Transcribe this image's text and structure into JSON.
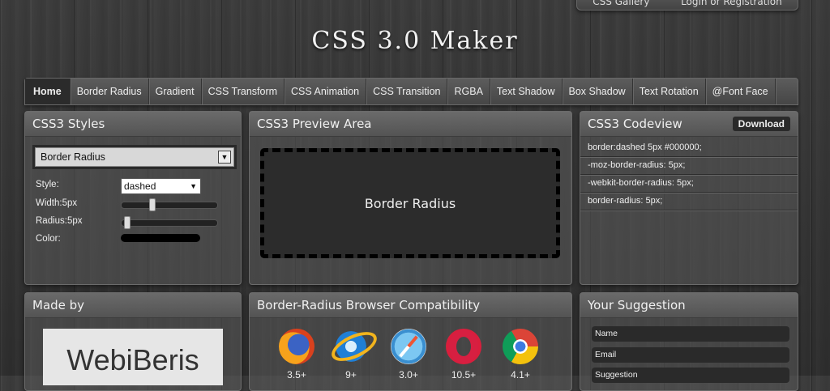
{
  "top_links": {
    "gallery": "CSS Gallery",
    "login": "Login or Registration"
  },
  "logo": "CSS 3.0 Maker",
  "nav": {
    "tabs": [
      "Home",
      "Border Radius",
      "Gradient",
      "CSS Transform",
      "CSS Animation",
      "CSS Transition",
      "RGBA",
      "Text Shadow",
      "Box Shadow",
      "Text Rotation",
      "@Font Face"
    ],
    "active_index": 0
  },
  "styles_panel": {
    "title": "CSS3 Styles",
    "selected_style": "Border Radius",
    "style_label": "Style:",
    "style_value": "dashed",
    "width_label": "Width:5px",
    "width_value": 5,
    "radius_label": "Radius:5px",
    "radius_value": 5,
    "color_label": "Color:",
    "color_value": "#000000"
  },
  "preview_panel": {
    "title": "CSS3 Preview Area",
    "preview_text": "Border Radius"
  },
  "codeview_panel": {
    "title": "CSS3 Codeview",
    "download_label": "Download",
    "lines": [
      "border:dashed 5px #000000;",
      "-moz-border-radius: 5px;",
      "-webkit-border-radius: 5px;",
      "border-radius: 5px;"
    ]
  },
  "madeby_panel": {
    "title": "Made by",
    "brand": "WebiBeris"
  },
  "compat_panel": {
    "title": "Border-Radius Browser Compatibility",
    "browsers": [
      {
        "icon": "firefox-icon",
        "version": "3.5+"
      },
      {
        "icon": "ie-icon",
        "version": "9+"
      },
      {
        "icon": "safari-icon",
        "version": "3.0+"
      },
      {
        "icon": "opera-icon",
        "version": "10.5+"
      },
      {
        "icon": "chrome-icon",
        "version": "4.1+"
      }
    ]
  },
  "suggestion_panel": {
    "title": "Your Suggestion",
    "fields": [
      "Name",
      "Email",
      "Suggestion"
    ]
  }
}
